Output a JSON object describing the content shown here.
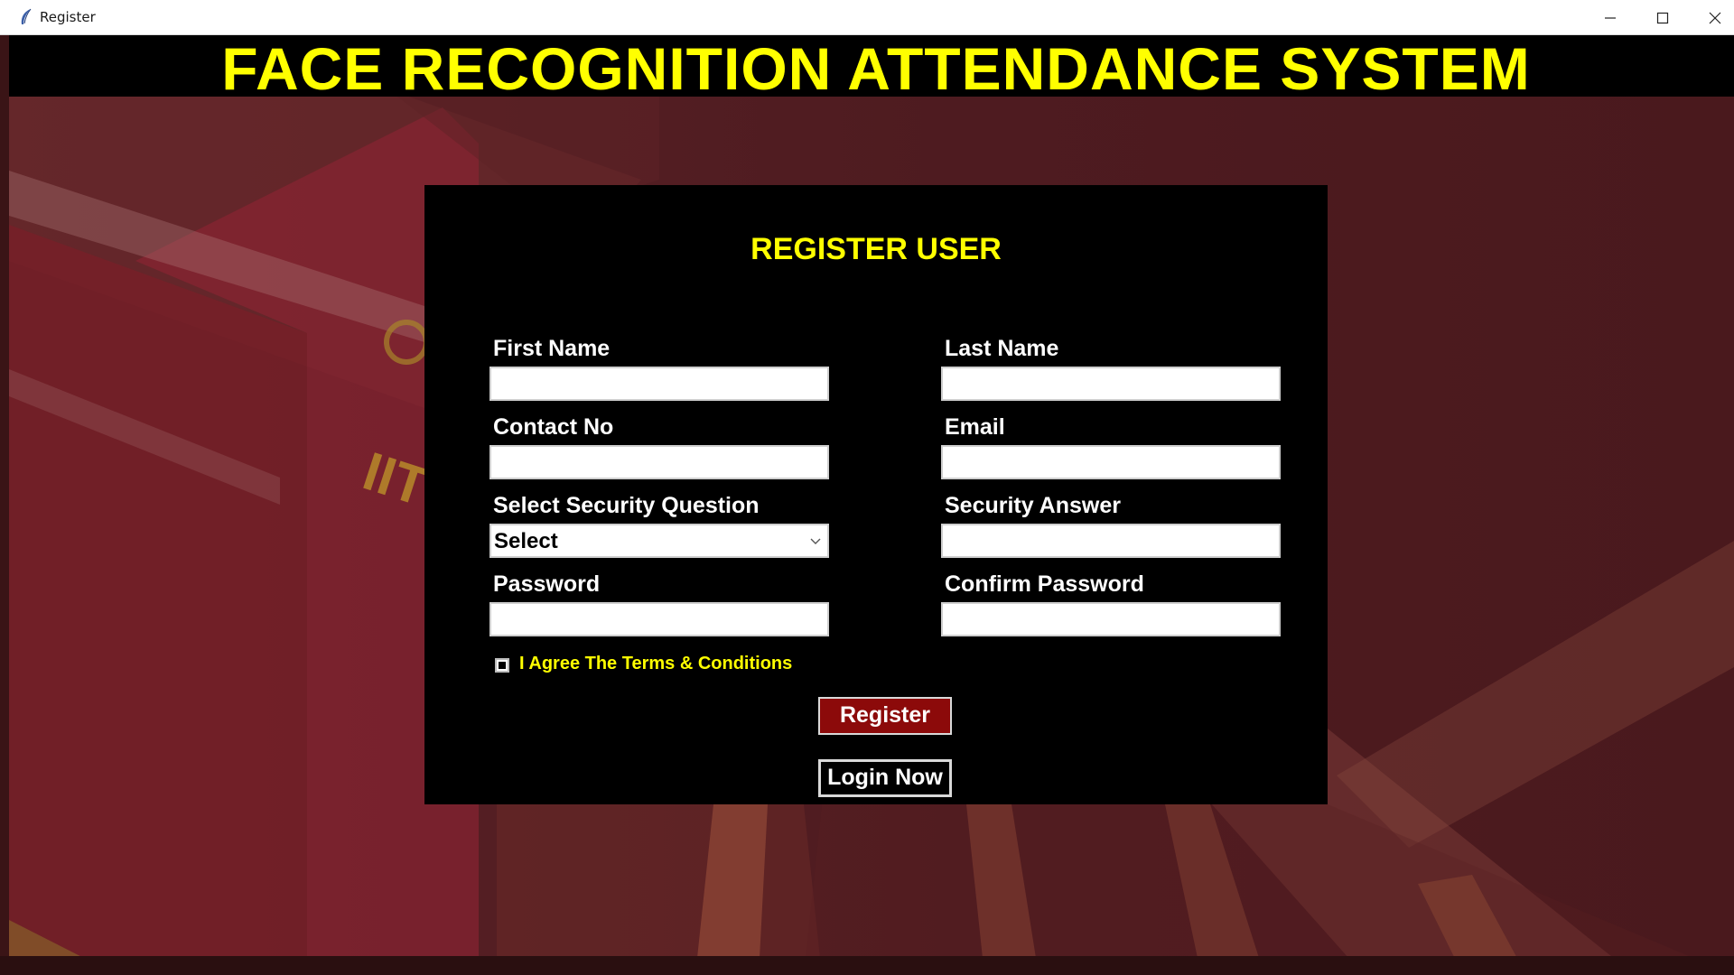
{
  "window": {
    "title": "Register",
    "icon": "feather-icon"
  },
  "header": {
    "title": "FACE RECOGNITION ATTENDANCE SYSTEM"
  },
  "form": {
    "title": "REGISTER USER",
    "fields": {
      "first_name": {
        "label": "First Name",
        "value": ""
      },
      "last_name": {
        "label": "Last Name",
        "value": ""
      },
      "contact_no": {
        "label": "Contact No",
        "value": ""
      },
      "email": {
        "label": "Email",
        "value": ""
      },
      "security_question": {
        "label": "Select Security Question",
        "value": "Select"
      },
      "security_answer": {
        "label": "Security Answer",
        "value": ""
      },
      "password": {
        "label": "Password",
        "value": ""
      },
      "confirm_password": {
        "label": "Confirm Password",
        "value": ""
      }
    },
    "agree": {
      "label": "I Agree The Terms & Conditions",
      "checked": false
    },
    "register_button": "Register",
    "login_button": "Login Now"
  },
  "colors": {
    "accent_yellow": "#ffff00",
    "register_button": "#8c0a0a",
    "panel": "#000000",
    "background": "#4e1b20"
  }
}
